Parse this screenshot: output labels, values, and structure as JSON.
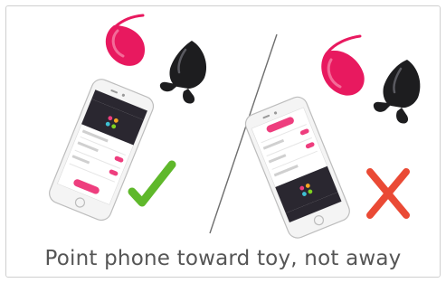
{
  "caption": "Point phone toward toy, not away",
  "colors": {
    "accent_pink": "#ee3e7e",
    "toy_pink": "#e8195f",
    "check_green": "#5fb82b",
    "cross_red": "#ea4a35",
    "phone_screen_dark": "#2a2730"
  },
  "icons": {
    "correct": "check-icon",
    "incorrect": "cross-icon"
  }
}
